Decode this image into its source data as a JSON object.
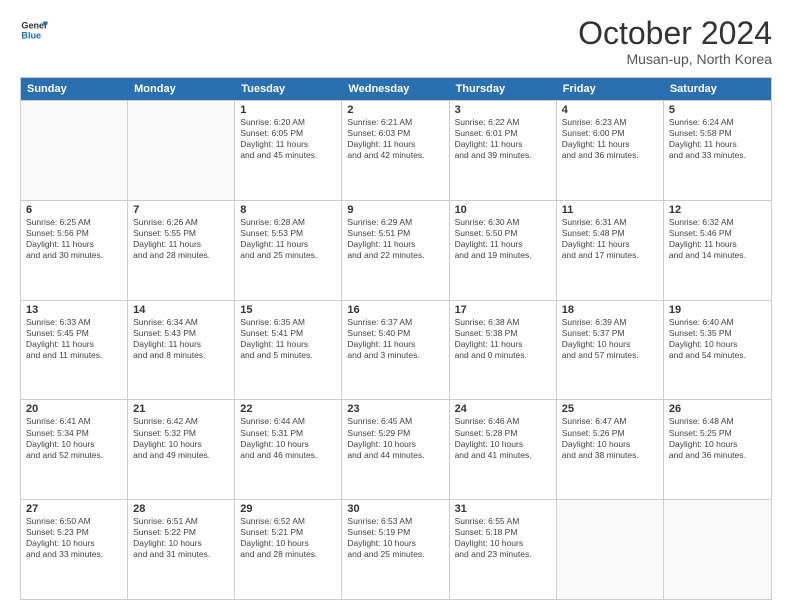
{
  "header": {
    "logo_line1": "General",
    "logo_line2": "Blue",
    "title": "October 2024",
    "subtitle": "Musan-up, North Korea"
  },
  "weekdays": [
    "Sunday",
    "Monday",
    "Tuesday",
    "Wednesday",
    "Thursday",
    "Friday",
    "Saturday"
  ],
  "weeks": [
    [
      {
        "day": "",
        "sunrise": "",
        "sunset": "",
        "daylight": ""
      },
      {
        "day": "",
        "sunrise": "",
        "sunset": "",
        "daylight": ""
      },
      {
        "day": "1",
        "sunrise": "Sunrise: 6:20 AM",
        "sunset": "Sunset: 6:05 PM",
        "daylight": "Daylight: 11 hours and 45 minutes."
      },
      {
        "day": "2",
        "sunrise": "Sunrise: 6:21 AM",
        "sunset": "Sunset: 6:03 PM",
        "daylight": "Daylight: 11 hours and 42 minutes."
      },
      {
        "day": "3",
        "sunrise": "Sunrise: 6:22 AM",
        "sunset": "Sunset: 6:01 PM",
        "daylight": "Daylight: 11 hours and 39 minutes."
      },
      {
        "day": "4",
        "sunrise": "Sunrise: 6:23 AM",
        "sunset": "Sunset: 6:00 PM",
        "daylight": "Daylight: 11 hours and 36 minutes."
      },
      {
        "day": "5",
        "sunrise": "Sunrise: 6:24 AM",
        "sunset": "Sunset: 5:58 PM",
        "daylight": "Daylight: 11 hours and 33 minutes."
      }
    ],
    [
      {
        "day": "6",
        "sunrise": "Sunrise: 6:25 AM",
        "sunset": "Sunset: 5:56 PM",
        "daylight": "Daylight: 11 hours and 30 minutes."
      },
      {
        "day": "7",
        "sunrise": "Sunrise: 6:26 AM",
        "sunset": "Sunset: 5:55 PM",
        "daylight": "Daylight: 11 hours and 28 minutes."
      },
      {
        "day": "8",
        "sunrise": "Sunrise: 6:28 AM",
        "sunset": "Sunset: 5:53 PM",
        "daylight": "Daylight: 11 hours and 25 minutes."
      },
      {
        "day": "9",
        "sunrise": "Sunrise: 6:29 AM",
        "sunset": "Sunset: 5:51 PM",
        "daylight": "Daylight: 11 hours and 22 minutes."
      },
      {
        "day": "10",
        "sunrise": "Sunrise: 6:30 AM",
        "sunset": "Sunset: 5:50 PM",
        "daylight": "Daylight: 11 hours and 19 minutes."
      },
      {
        "day": "11",
        "sunrise": "Sunrise: 6:31 AM",
        "sunset": "Sunset: 5:48 PM",
        "daylight": "Daylight: 11 hours and 17 minutes."
      },
      {
        "day": "12",
        "sunrise": "Sunrise: 6:32 AM",
        "sunset": "Sunset: 5:46 PM",
        "daylight": "Daylight: 11 hours and 14 minutes."
      }
    ],
    [
      {
        "day": "13",
        "sunrise": "Sunrise: 6:33 AM",
        "sunset": "Sunset: 5:45 PM",
        "daylight": "Daylight: 11 hours and 11 minutes."
      },
      {
        "day": "14",
        "sunrise": "Sunrise: 6:34 AM",
        "sunset": "Sunset: 5:43 PM",
        "daylight": "Daylight: 11 hours and 8 minutes."
      },
      {
        "day": "15",
        "sunrise": "Sunrise: 6:35 AM",
        "sunset": "Sunset: 5:41 PM",
        "daylight": "Daylight: 11 hours and 5 minutes."
      },
      {
        "day": "16",
        "sunrise": "Sunrise: 6:37 AM",
        "sunset": "Sunset: 5:40 PM",
        "daylight": "Daylight: 11 hours and 3 minutes."
      },
      {
        "day": "17",
        "sunrise": "Sunrise: 6:38 AM",
        "sunset": "Sunset: 5:38 PM",
        "daylight": "Daylight: 11 hours and 0 minutes."
      },
      {
        "day": "18",
        "sunrise": "Sunrise: 6:39 AM",
        "sunset": "Sunset: 5:37 PM",
        "daylight": "Daylight: 10 hours and 57 minutes."
      },
      {
        "day": "19",
        "sunrise": "Sunrise: 6:40 AM",
        "sunset": "Sunset: 5:35 PM",
        "daylight": "Daylight: 10 hours and 54 minutes."
      }
    ],
    [
      {
        "day": "20",
        "sunrise": "Sunrise: 6:41 AM",
        "sunset": "Sunset: 5:34 PM",
        "daylight": "Daylight: 10 hours and 52 minutes."
      },
      {
        "day": "21",
        "sunrise": "Sunrise: 6:42 AM",
        "sunset": "Sunset: 5:32 PM",
        "daylight": "Daylight: 10 hours and 49 minutes."
      },
      {
        "day": "22",
        "sunrise": "Sunrise: 6:44 AM",
        "sunset": "Sunset: 5:31 PM",
        "daylight": "Daylight: 10 hours and 46 minutes."
      },
      {
        "day": "23",
        "sunrise": "Sunrise: 6:45 AM",
        "sunset": "Sunset: 5:29 PM",
        "daylight": "Daylight: 10 hours and 44 minutes."
      },
      {
        "day": "24",
        "sunrise": "Sunrise: 6:46 AM",
        "sunset": "Sunset: 5:28 PM",
        "daylight": "Daylight: 10 hours and 41 minutes."
      },
      {
        "day": "25",
        "sunrise": "Sunrise: 6:47 AM",
        "sunset": "Sunset: 5:26 PM",
        "daylight": "Daylight: 10 hours and 38 minutes."
      },
      {
        "day": "26",
        "sunrise": "Sunrise: 6:48 AM",
        "sunset": "Sunset: 5:25 PM",
        "daylight": "Daylight: 10 hours and 36 minutes."
      }
    ],
    [
      {
        "day": "27",
        "sunrise": "Sunrise: 6:50 AM",
        "sunset": "Sunset: 5:23 PM",
        "daylight": "Daylight: 10 hours and 33 minutes."
      },
      {
        "day": "28",
        "sunrise": "Sunrise: 6:51 AM",
        "sunset": "Sunset: 5:22 PM",
        "daylight": "Daylight: 10 hours and 31 minutes."
      },
      {
        "day": "29",
        "sunrise": "Sunrise: 6:52 AM",
        "sunset": "Sunset: 5:21 PM",
        "daylight": "Daylight: 10 hours and 28 minutes."
      },
      {
        "day": "30",
        "sunrise": "Sunrise: 6:53 AM",
        "sunset": "Sunset: 5:19 PM",
        "daylight": "Daylight: 10 hours and 25 minutes."
      },
      {
        "day": "31",
        "sunrise": "Sunrise: 6:55 AM",
        "sunset": "Sunset: 5:18 PM",
        "daylight": "Daylight: 10 hours and 23 minutes."
      },
      {
        "day": "",
        "sunrise": "",
        "sunset": "",
        "daylight": ""
      },
      {
        "day": "",
        "sunrise": "",
        "sunset": "",
        "daylight": ""
      }
    ]
  ]
}
